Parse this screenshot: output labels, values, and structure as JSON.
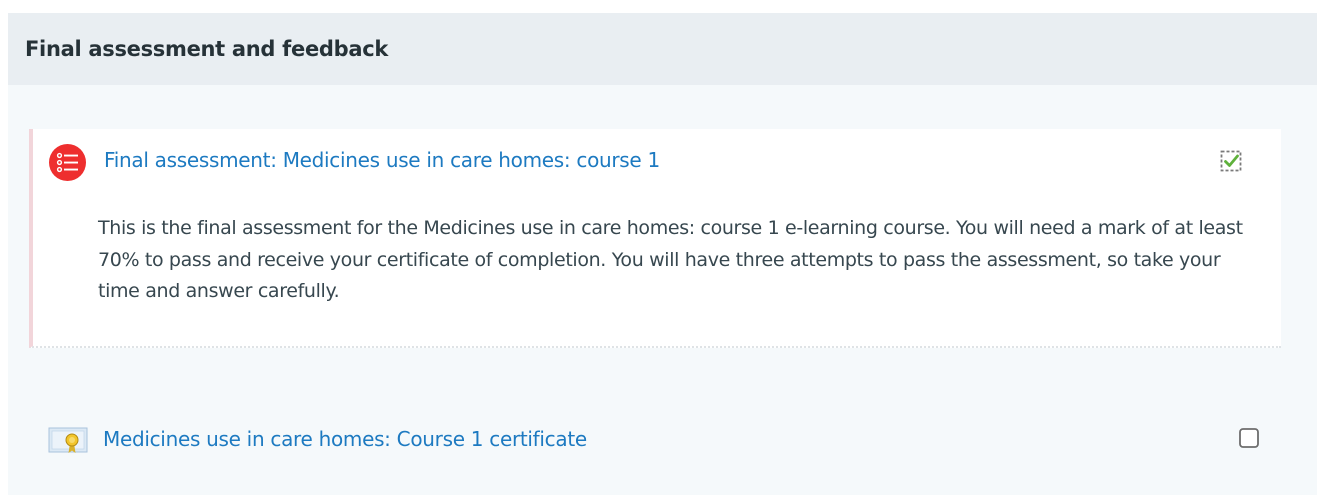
{
  "section": {
    "title": "Final assessment and feedback"
  },
  "activities": [
    {
      "type": "quiz",
      "icon": "quiz-list-icon",
      "title": "Final assessment: Medicines use in care homes: course 1",
      "description": "This is the final assessment for the Medicines use in care homes: course 1 e-learning course. You will need a mark of at least 70% to pass and receive your certificate of completion. You will have three attempts to pass the assessment, so take your time and answer carefully.",
      "completed": true
    },
    {
      "type": "certificate",
      "icon": "certificate-icon",
      "title": "Medicines use in care homes: Course 1 certificate",
      "completed": false
    }
  ],
  "colors": {
    "link": "#1d7ac1",
    "quiz_icon_bg": "#ee2e2e",
    "check_green": "#5fb13c",
    "header_bg": "#e9eef2",
    "section_bg": "#f5f9fb"
  }
}
